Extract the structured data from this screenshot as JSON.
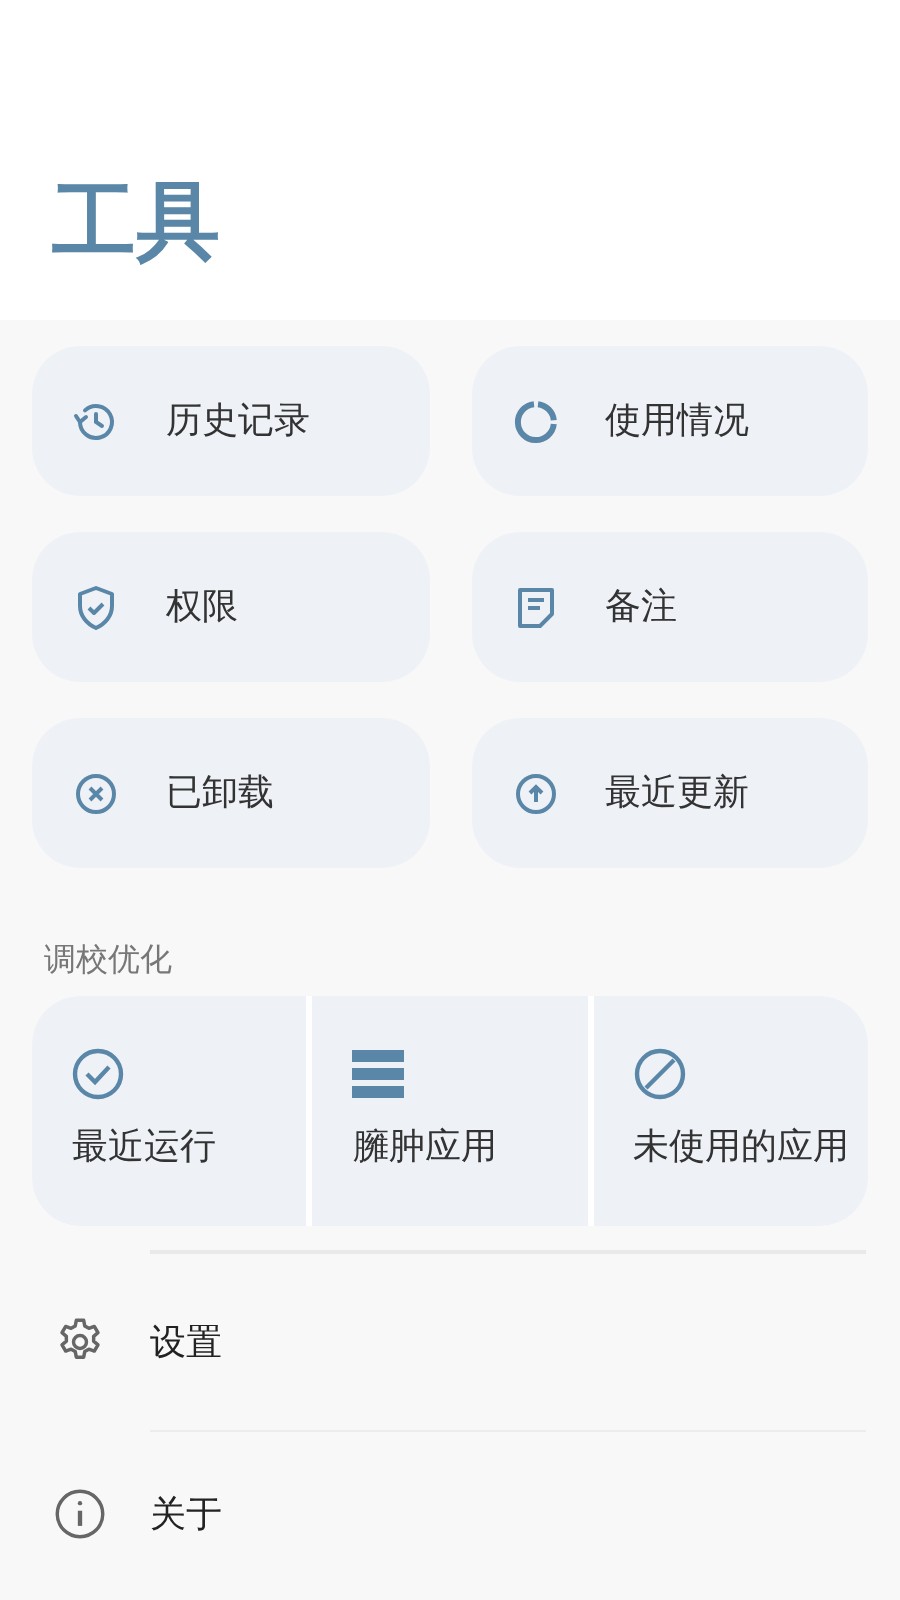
{
  "title": "工具",
  "tools": [
    {
      "label": "历史记录"
    },
    {
      "label": "使用情况"
    },
    {
      "label": "权限"
    },
    {
      "label": "备注"
    },
    {
      "label": "已卸载"
    },
    {
      "label": "最近更新"
    }
  ],
  "optimization": {
    "heading": "调校优化",
    "items": [
      {
        "label": "最近运行"
      },
      {
        "label": "臃肿应用"
      },
      {
        "label": "未使用的应用"
      }
    ]
  },
  "menu": [
    {
      "label": "设置"
    },
    {
      "label": "关于"
    }
  ]
}
